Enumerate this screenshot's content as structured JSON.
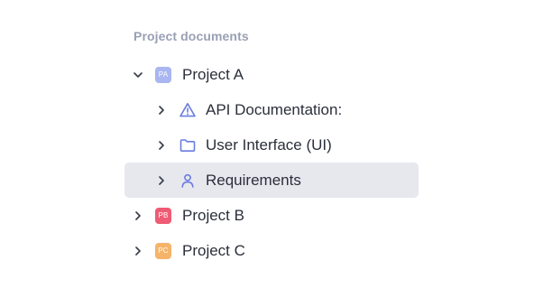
{
  "section": {
    "title": "Project documents"
  },
  "colors": {
    "accent_icon": "#6a7ce0",
    "chevron": "#3a3f4b",
    "selected_bg": "#e6e8ee",
    "badge_project_a": "#a9b6f0",
    "badge_project_b": "#ef5b74",
    "badge_project_c": "#f5b46a"
  },
  "tree": {
    "project_a": {
      "badge": "PA",
      "label": "Project A",
      "expanded": true,
      "children": [
        {
          "label": "API Documentation:",
          "icon": "warning-triangle-icon",
          "expanded": false
        },
        {
          "label": "User Interface (UI)",
          "icon": "folder-icon",
          "expanded": false
        },
        {
          "label": "Requirements",
          "icon": "person-icon",
          "expanded": false,
          "selected": true
        }
      ]
    },
    "project_b": {
      "badge": "PB",
      "label": "Project B",
      "expanded": false
    },
    "project_c": {
      "badge": "PC",
      "label": "Project C",
      "expanded": false
    }
  }
}
